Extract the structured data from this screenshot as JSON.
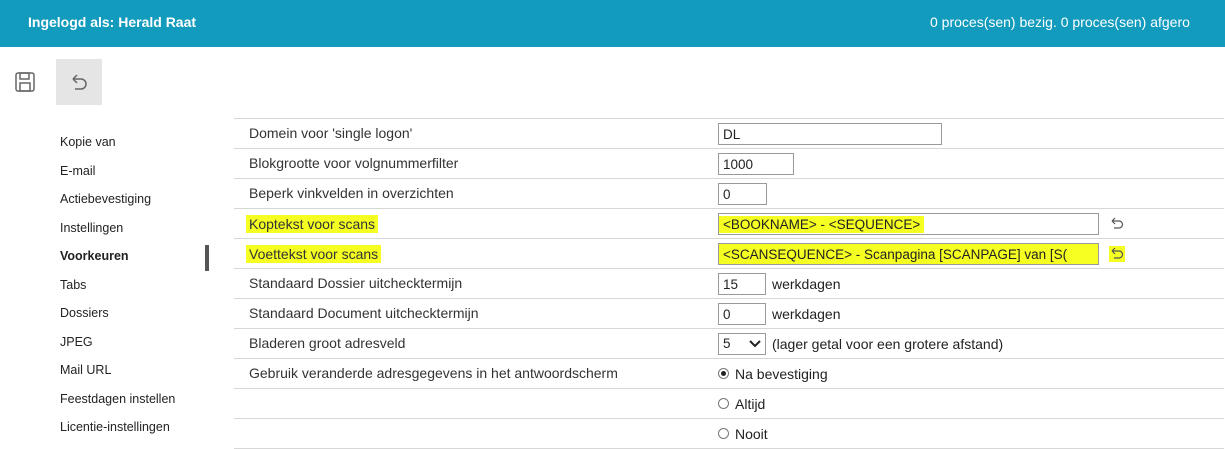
{
  "header": {
    "user": "Ingelogd als: Herald Raat",
    "status": "0 proces(sen) bezig. 0 proces(sen) afgero"
  },
  "toolbar": {
    "save": "save-icon",
    "undo": "undo-icon"
  },
  "sidebar": {
    "items": [
      {
        "label": "Kopie van"
      },
      {
        "label": "E-mail"
      },
      {
        "label": "Actiebevestiging"
      },
      {
        "label": "Instellingen"
      },
      {
        "label": "Voorkeuren"
      },
      {
        "label": "Tabs"
      },
      {
        "label": "Dossiers"
      },
      {
        "label": "JPEG"
      },
      {
        "label": "Mail URL"
      },
      {
        "label": "Feestdagen instellen"
      },
      {
        "label": "Licentie-instellingen"
      }
    ],
    "active": "Voorkeuren"
  },
  "form": {
    "domain": {
      "label": "Domein voor 'single logon'",
      "value": "DL"
    },
    "blocksize": {
      "label": "Blokgrootte voor volgnummerfilter",
      "value": "1000"
    },
    "limit": {
      "label": "Beperk vinkvelden in overzichten",
      "value": "0"
    },
    "header_scans": {
      "label": "Koptekst voor scans",
      "value": "<BOOKNAME> - <SEQUENCE>"
    },
    "footer_scans": {
      "label": "Voettekst voor scans",
      "value": "<SCANSEQUENCE> - Scanpagina [SCANPAGE] van [S("
    },
    "dossier_checkout": {
      "label": "Standaard Dossier uitchecktermijn",
      "value": "15",
      "unit": "werkdagen"
    },
    "document_checkout": {
      "label": "Standaard Document uitchecktermijn",
      "value": "0",
      "unit": "werkdagen"
    },
    "browse": {
      "label": "Bladeren groot adresveld",
      "value": "5",
      "hint": "(lager getal voor een grotere afstand)"
    },
    "address_changes": {
      "label": "Gebruik veranderde adresgegevens in het antwoordscherm",
      "options": [
        "Na bevestiging",
        "Altijd",
        "Nooit"
      ],
      "selected": "Na bevestiging"
    }
  },
  "colors": {
    "header_bg": "#129bbd",
    "highlight": "#f5ff22"
  }
}
